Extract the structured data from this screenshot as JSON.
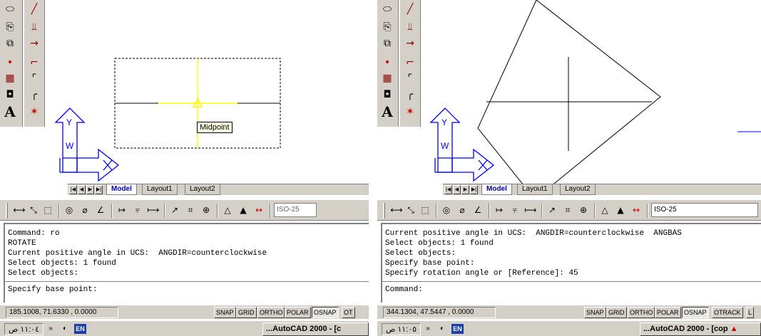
{
  "left": {
    "tabs": {
      "model": "Model",
      "layout1": "Layout1",
      "layout2": "Layout2"
    },
    "tooltip": "Midpoint",
    "ucs": {
      "y": "Y",
      "w": "W",
      "x": "X"
    },
    "text_style": "ISO-25",
    "command_lines": [
      "Command: ro",
      "ROTATE",
      "Current positive angle in UCS:  ANGDIR=counterclockwise  ",
      "Select objects: 1 found",
      "Select objects:"
    ],
    "prompt": "Specify base point:",
    "coords": "185.1008, 71.6330 , 0.0000",
    "status_buttons": [
      "SNAP",
      "GRID",
      "ORTHO",
      "POLAR",
      "OSNAP",
      "OT"
    ],
    "tray_time": "١١:٠٤ ص",
    "tray_more": "»",
    "lang": "EN",
    "task_label": "...AutoCAD 2000 - [c"
  },
  "right": {
    "tabs": {
      "model": "Model",
      "layout1": "Layout1",
      "layout2": "Layout2"
    },
    "ucs": {
      "y": "Y",
      "w": "W",
      "x": "X"
    },
    "text_style": "ISO-25",
    "command_lines": [
      "Current positive angle in UCS:  ANGDIR=counterclockwise  ANGBAS",
      "Select objects: 1 found",
      "Select objects:",
      "Specify base point:",
      "Specify rotation angle or [Reference]: 45"
    ],
    "prompt": "Command:",
    "coords": "344.1304, 47.5447 , 0.0000",
    "status_buttons": [
      "SNAP",
      "GRID",
      "ORTHO",
      "POLAR",
      "OSNAP",
      "OTRACK",
      "L"
    ],
    "tray_time": "١١:٠٥ ص",
    "tray_more": "»",
    "lang": "EN",
    "task_label": "...AutoCAD 2000 - [cop"
  },
  "icons": {
    "left_column": [
      "ellipse-icon",
      "insert-block-icon",
      "make-block-icon",
      "point-icon",
      "hatch-icon",
      "region-icon",
      "multiline-text-icon"
    ],
    "right_column": [
      "erase-line-icon",
      "trim-icon",
      "extend-icon",
      "break-icon",
      "chamfer-icon",
      "fillet-icon",
      "explode-icon"
    ],
    "dimension_toolbar": [
      "linear-dim-icon",
      "aligned-dim-icon",
      "ordinate-dim-icon",
      "radius-dim-icon",
      "diameter-dim-icon",
      "angular-dim-icon",
      "quick-dim-icon",
      "baseline-dim-icon",
      "continue-dim-icon",
      "leader-icon",
      "tolerance-icon",
      "center-mark-icon",
      "dim-edit-icon",
      "dim-text-edit-icon",
      "dim-update-icon"
    ]
  },
  "colors": {
    "toolbar_bg": "#d4d0c8",
    "selection_highlight": "#ffff00",
    "ucs_icon": "#0000ff",
    "tooltip_bg": "#ffffe1",
    "language_badge": "#1d3fa8"
  }
}
